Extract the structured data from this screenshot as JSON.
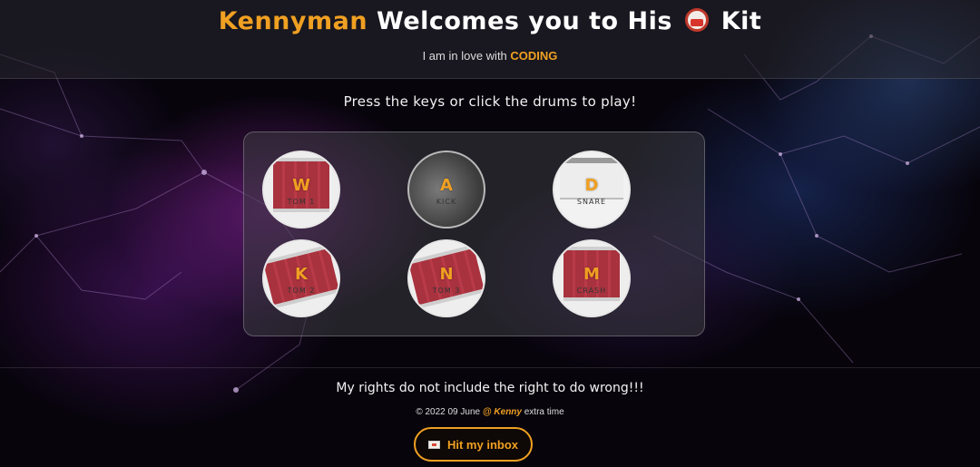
{
  "header": {
    "title_name": "Kennyman",
    "title_rest_1": " Welcomes you to His ",
    "title_icon": "drum-icon",
    "title_rest_2": " Kit",
    "subtitle_prefix": "I am in love with ",
    "subtitle_highlight": "CODING"
  },
  "instructions": "Press the keys or click the drums to play!",
  "drums": [
    {
      "key": "W",
      "name": "TOM 1"
    },
    {
      "key": "A",
      "name": "KICK"
    },
    {
      "key": "D",
      "name": "SNARE"
    },
    {
      "key": "K",
      "name": "TOM 2"
    },
    {
      "key": "N",
      "name": "TOM 3"
    },
    {
      "key": "M",
      "name": "CRASH"
    }
  ],
  "footer": {
    "quote": "My rights do not include the right to do wrong!!!",
    "copyright_prefix": "© 2022 09 June ",
    "copyright_author": "@ Kenny",
    "copyright_suffix": " extra time",
    "inbox_label": "Hit my inbox",
    "inbox_icon": "mail-icon"
  },
  "colors": {
    "accent": "#f0a022",
    "background": "#07040c"
  }
}
